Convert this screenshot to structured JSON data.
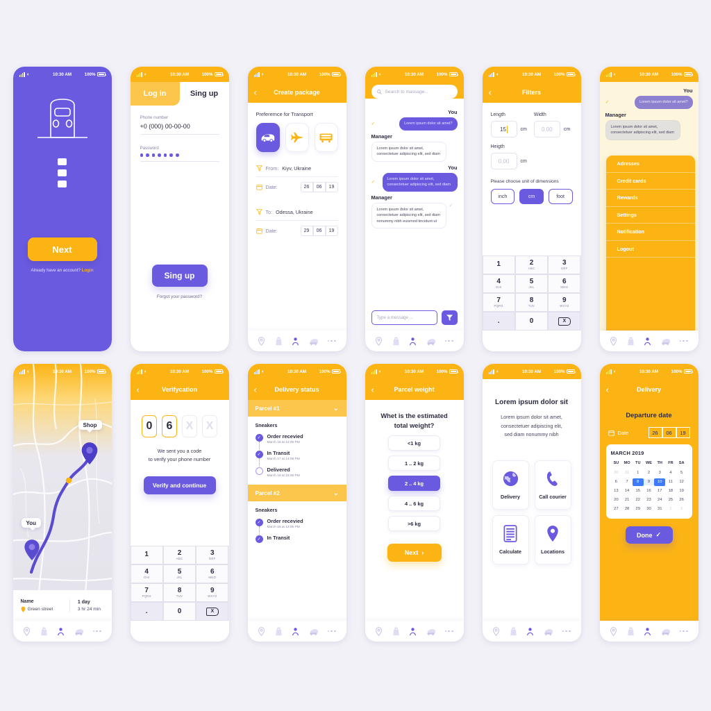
{
  "status_bar": {
    "time": "10:30 AM",
    "battery": "100%"
  },
  "bottom_nav": {
    "items": [
      "location-pin",
      "shopping-bag",
      "person",
      "car",
      "more"
    ]
  },
  "screens": [
    {
      "id": "onboarding",
      "illustration": "train-icon",
      "next_label": "Next",
      "account_prompt": "Already have an account?",
      "login_link": "Login"
    },
    {
      "id": "signup",
      "tab_login": "Log in",
      "tab_signup": "Sing up",
      "phone_label": "Phone number",
      "phone_value": "+0 (000) 00-00-00",
      "password_label": "Password",
      "password_dots": 7,
      "submit_label": "Sing up",
      "forgot_label": "Forgot your password?"
    },
    {
      "id": "create-package",
      "title": "Create package",
      "section_label": "Preferemce for Transport",
      "transports": [
        "car-icon",
        "plane-icon",
        "bus-icon"
      ],
      "from_label": "From:",
      "from_value": "Kiyv, Ukraine",
      "from_date_label": "Date:",
      "from_date": [
        "26",
        "06",
        "19"
      ],
      "to_label": "To:",
      "to_value": "Odessa, Ukraine",
      "to_date_label": "Date:",
      "to_date": [
        "29",
        "06",
        "19"
      ]
    },
    {
      "id": "chat",
      "search_placeholder": "Search to massage...",
      "label_you": "You",
      "label_manager": "Manager",
      "msg1_you": "Lorem ipsum dolor sit amet?",
      "msg2_manager": "Lorem ipsum dolor sit amet, consectetuer adipiscing elit, sed diam",
      "msg3_you": "Lorem ipsum dolor sit amet, consectetuer adipiscing elit, sed diam",
      "msg4_manager": "Lorem ipsum dolor sit amet, consectetuer adipiscing elit, sed diam nonummy nibh euismod tincidunt ut",
      "composer_placeholder": "Type a message ..."
    },
    {
      "id": "filters",
      "title": "Filters",
      "length_label": "Length",
      "length_value": "15",
      "length_unit": "cm",
      "width_label": "Width",
      "width_value": "0.00",
      "width_unit": "cm",
      "height_label": "Heigth",
      "height_value": "0.00",
      "height_unit": "cm",
      "choose_label": "Please choose unit of dimensions",
      "units": [
        "inch",
        "cm",
        "foot"
      ],
      "unit_selected": "cm"
    },
    {
      "id": "menu",
      "label_you": "You",
      "label_manager": "Manager",
      "msg_you": "Lorem ipsum dolor sit amet?",
      "msg_manager": "Lorem ipsum dolor sit amet, consectetuer adipiscing elit, sed diam",
      "items": [
        "Adresses",
        "Credit cards",
        "Rewards",
        "Settings",
        "Notification",
        "Logout"
      ]
    },
    {
      "id": "map",
      "pin_shop": "Shop",
      "pin_you": "You",
      "name_label": "Name",
      "street": "Green street",
      "duration_days": "1 day",
      "duration_time": "3 hr  24 min"
    },
    {
      "id": "verification",
      "title": "Verifycation",
      "code": [
        "0",
        "6",
        "X",
        "X"
      ],
      "hint_line1": "We sent you a code",
      "hint_line2": "to verify your phone number",
      "submit_label": "Verify and continue"
    },
    {
      "id": "delivery-status",
      "title": "Delivery status",
      "parcels": [
        {
          "header": "Parcel #1",
          "item": "Sneakers",
          "steps": [
            {
              "name": "Order recevied",
              "time": "March 16 at 12:06 PM",
              "done": true
            },
            {
              "name": "In Transit",
              "time": "March 17 at 14:06 PM",
              "done": true
            },
            {
              "name": "Delivered",
              "time": "March 18 at 15:06 PM",
              "done": false
            }
          ]
        },
        {
          "header": "Parcel #2",
          "item": "Sneakers",
          "steps": [
            {
              "name": "Order recevied",
              "time": "March 16 at 12:06 PM",
              "done": true
            },
            {
              "name": "In Transit",
              "time": "",
              "done": true
            }
          ]
        }
      ]
    },
    {
      "id": "parcel-weight",
      "title": "Parcel weight",
      "question_line1": "Whet is the estimated",
      "question_line2": "total weight?",
      "options": [
        "<1 kg",
        "1 .. 2 kg",
        "2 .. 4 kg",
        "4 .. 6 kg",
        ">6 kg"
      ],
      "selected": "2 .. 4 kg",
      "next_label": "Next"
    },
    {
      "id": "services",
      "heading": "Lorem ipsum dolor sit",
      "paragraph_line1": "Lorem ipsum dolor sit amet,",
      "paragraph_line2": "consectetuer adipiscing elit,",
      "paragraph_line3": "sed diam nonummy nibh",
      "cards": [
        {
          "label": "Delivery",
          "icon": "globe-icon"
        },
        {
          "label": "Call courier",
          "icon": "phone-icon"
        },
        {
          "label": "Calculate",
          "icon": "document-icon"
        },
        {
          "label": "Locations",
          "icon": "location-pin-icon"
        }
      ]
    },
    {
      "id": "delivery-calendar",
      "title": "Delivery",
      "subtitle": "Departure date",
      "date_label": "Date",
      "date_parts": [
        "26",
        "06",
        "19"
      ],
      "month": "MARCH 2019",
      "weekdays": [
        "SU",
        "MO",
        "TU",
        "WE",
        "TH",
        "FR",
        "SA"
      ],
      "weeks": [
        [
          {
            "n": "30",
            "t": "mut"
          },
          {
            "n": "31",
            "t": "mut"
          },
          {
            "n": "1"
          },
          {
            "n": "2"
          },
          {
            "n": "3"
          },
          {
            "n": "4"
          },
          {
            "n": "5"
          }
        ],
        [
          {
            "n": "6"
          },
          {
            "n": "7"
          },
          {
            "n": "8",
            "t": "selA"
          },
          {
            "n": "9",
            "t": "range"
          },
          {
            "n": "10",
            "t": "selB"
          },
          {
            "n": "11"
          },
          {
            "n": "12"
          }
        ],
        [
          {
            "n": "13"
          },
          {
            "n": "14"
          },
          {
            "n": "15"
          },
          {
            "n": "16"
          },
          {
            "n": "17"
          },
          {
            "n": "18"
          },
          {
            "n": "19"
          }
        ],
        [
          {
            "n": "20"
          },
          {
            "n": "21"
          },
          {
            "n": "22"
          },
          {
            "n": "23"
          },
          {
            "n": "24"
          },
          {
            "n": "25"
          },
          {
            "n": "26"
          }
        ],
        [
          {
            "n": "27"
          },
          {
            "n": "28"
          },
          {
            "n": "29"
          },
          {
            "n": "30"
          },
          {
            "n": "31"
          },
          {
            "n": "1",
            "t": "mut"
          },
          {
            "n": "2",
            "t": "mut"
          }
        ]
      ],
      "done_label": "Done"
    }
  ],
  "keypad": {
    "keys": [
      [
        {
          "d": "1",
          "l": ""
        },
        {
          "d": "2",
          "l": "ABC"
        },
        {
          "d": "3",
          "l": "DEF"
        }
      ],
      [
        {
          "d": "4",
          "l": "GHI"
        },
        {
          "d": "5",
          "l": "JKL"
        },
        {
          "d": "6",
          "l": "MNO"
        }
      ],
      [
        {
          "d": "7",
          "l": "PQRS"
        },
        {
          "d": "8",
          "l": "TUV"
        },
        {
          "d": "9",
          "l": "WXYZ"
        }
      ]
    ],
    "dot": ".",
    "zero": "0",
    "delete": "X"
  },
  "colors": {
    "purple": "#6a5ae0",
    "yellow": "#fcb415",
    "background": "#f2f1f7",
    "blue_select": "#3d7bfb"
  }
}
